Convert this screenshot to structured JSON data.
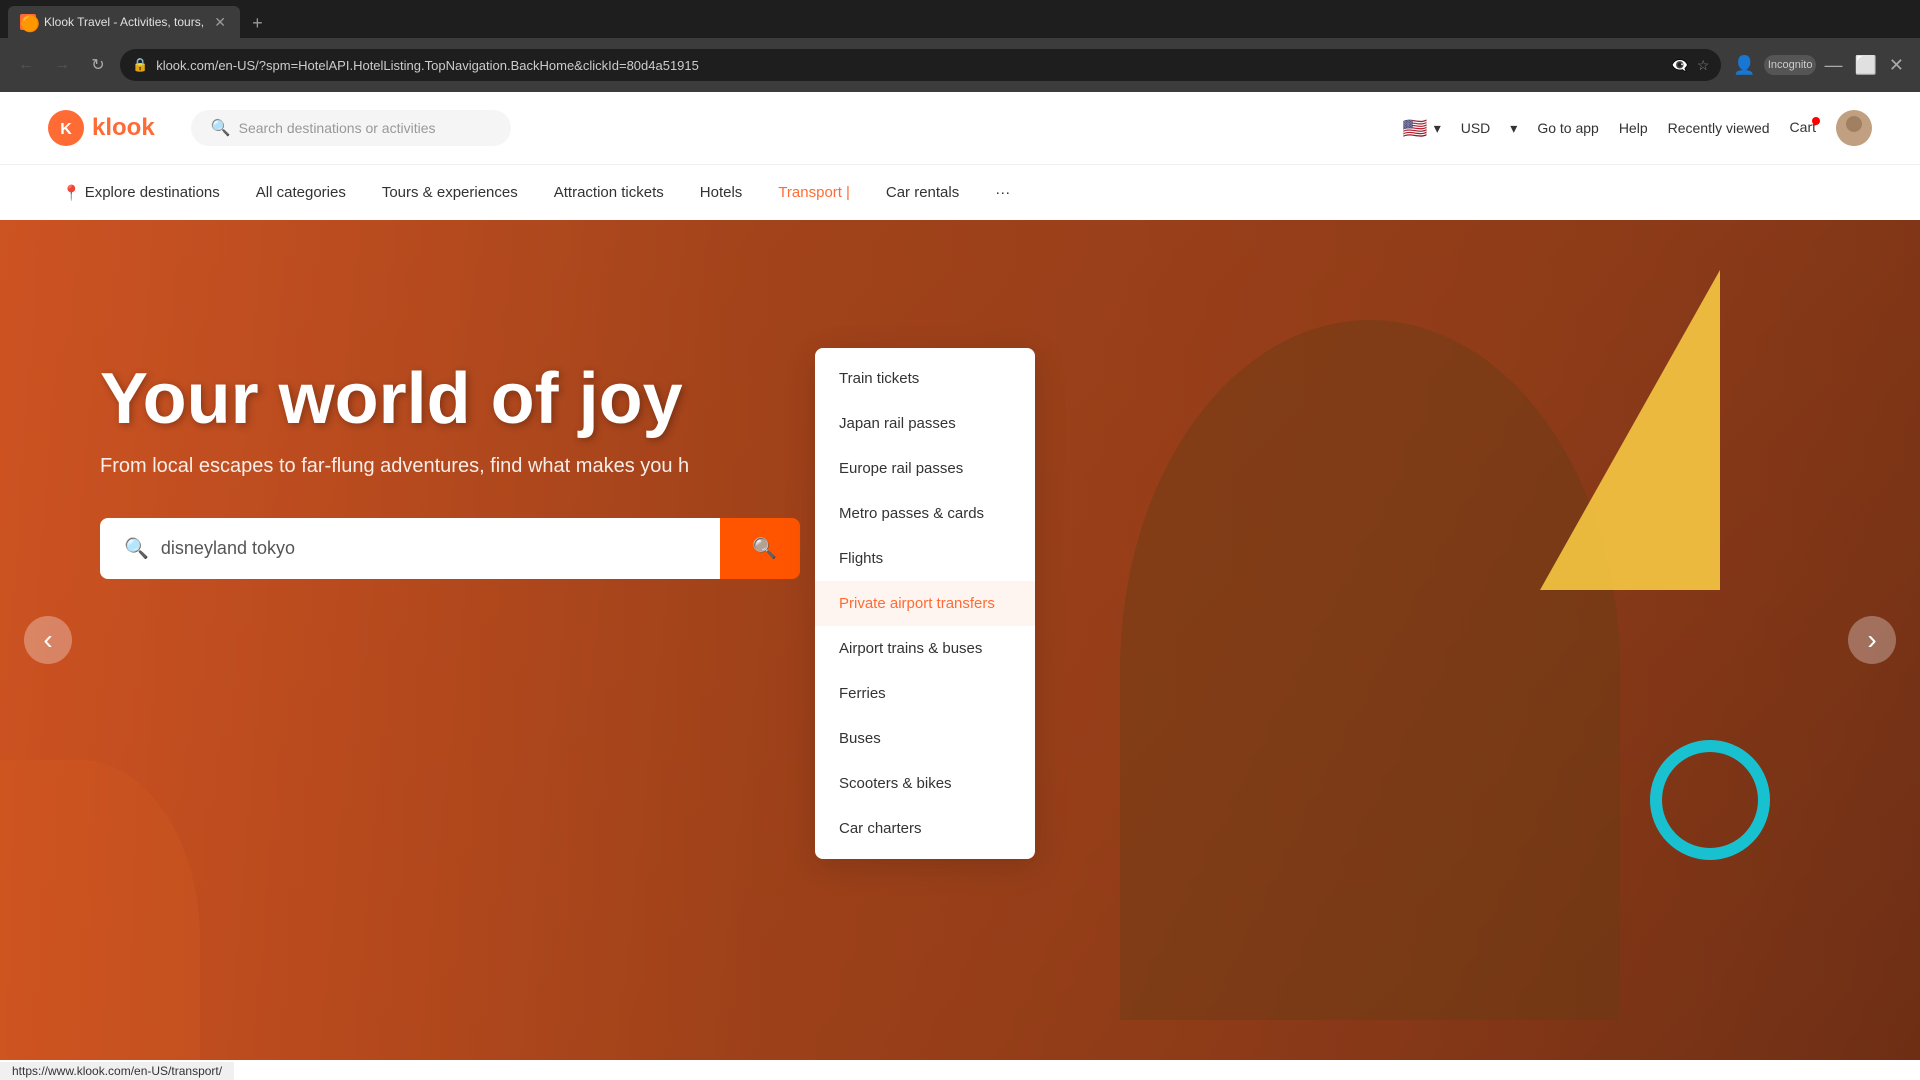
{
  "browser": {
    "tab": {
      "title": "Klook Travel - Activities, tours,",
      "favicon": "🟠"
    },
    "url": "klook.com/en-US/?spm=HotelAPI.HotelListing.TopNavigation.BackHome&clickId=80d4a51915",
    "incognito_label": "Incognito"
  },
  "nav": {
    "logo_text": "klook",
    "search_placeholder": "Search destinations or activities",
    "currency": "USD",
    "links": {
      "go_to_app": "Go to app",
      "help": "Help",
      "recently_viewed": "Recently viewed",
      "cart": "Cart"
    }
  },
  "categories": {
    "items": [
      {
        "label": "Explore destinations",
        "icon": "📍"
      },
      {
        "label": "All categories"
      },
      {
        "label": "Tours & experiences"
      },
      {
        "label": "Attraction tickets"
      },
      {
        "label": "Hotels"
      },
      {
        "label": "Transport"
      },
      {
        "label": "Car rentals"
      },
      {
        "label": "..."
      }
    ]
  },
  "hero": {
    "title": "Your world of joy",
    "subtitle": "From local escapes to far-flung adventures, find what makes you h",
    "search_value": "disneyland tokyo",
    "prev_label": "‹",
    "next_label": "›"
  },
  "transport_dropdown": {
    "items": [
      {
        "label": "Train tickets"
      },
      {
        "label": "Japan rail passes"
      },
      {
        "label": "Europe rail passes"
      },
      {
        "label": "Metro passes & cards"
      },
      {
        "label": "Flights"
      },
      {
        "label": "Private airport transfers",
        "highlighted": true
      },
      {
        "label": "Airport trains & buses"
      },
      {
        "label": "Ferries"
      },
      {
        "label": "Buses"
      },
      {
        "label": "Scooters & bikes"
      },
      {
        "label": "Car charters"
      }
    ]
  },
  "status_bar": {
    "url": "https://www.klook.com/en-US/transport/"
  }
}
